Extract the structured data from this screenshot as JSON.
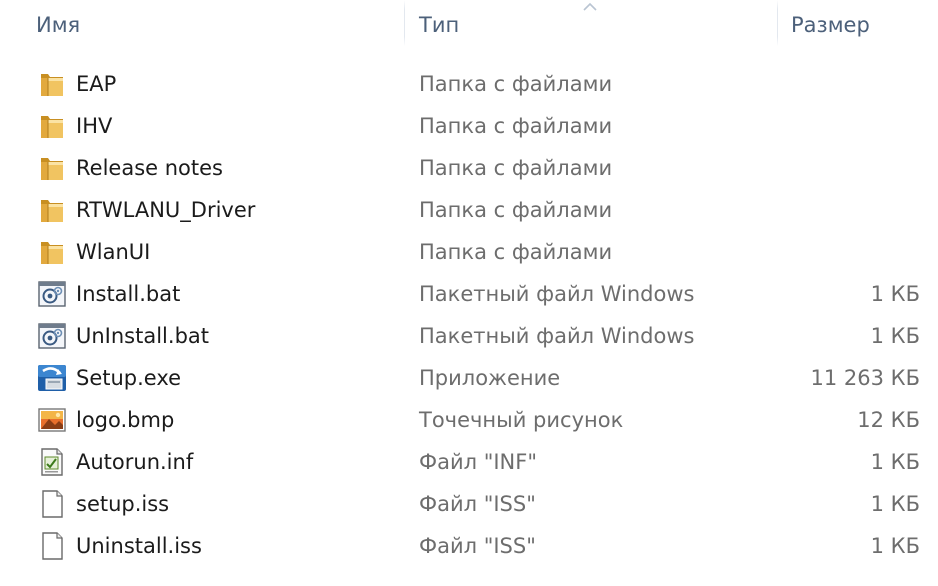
{
  "columns": {
    "name": "Имя",
    "type": "Тип",
    "size": "Размер"
  },
  "sort": {
    "column": "type",
    "direction": "ascending"
  },
  "colors": {
    "header_text": "#4c607a",
    "name_text": "#1b1b1b",
    "detail_text": "#6d6d6d",
    "folder": "#e8b44c"
  },
  "files": [
    {
      "name": "EAP",
      "type": "Папка с файлами",
      "size": "",
      "icon": "folder-icon"
    },
    {
      "name": "IHV",
      "type": "Папка с файлами",
      "size": "",
      "icon": "folder-icon"
    },
    {
      "name": "Release notes",
      "type": "Папка с файлами",
      "size": "",
      "icon": "folder-icon"
    },
    {
      "name": "RTWLANU_Driver",
      "type": "Папка с файлами",
      "size": "",
      "icon": "folder-icon"
    },
    {
      "name": "WlanUI",
      "type": "Папка с файлами",
      "size": "",
      "icon": "folder-icon"
    },
    {
      "name": "Install.bat",
      "type": "Пакетный файл Windows",
      "size": "1 КБ",
      "icon": "batch-file-icon"
    },
    {
      "name": "UnInstall.bat",
      "type": "Пакетный файл Windows",
      "size": "1 КБ",
      "icon": "batch-file-icon"
    },
    {
      "name": "Setup.exe",
      "type": "Приложение",
      "size": "11 263 КБ",
      "icon": "setup-installer-icon"
    },
    {
      "name": "logo.bmp",
      "type": "Точечный рисунок",
      "size": "12 КБ",
      "icon": "bitmap-image-icon"
    },
    {
      "name": "Autorun.inf",
      "type": "Файл \"INF\"",
      "size": "1 КБ",
      "icon": "inf-file-icon"
    },
    {
      "name": "setup.iss",
      "type": "Файл \"ISS\"",
      "size": "1 КБ",
      "icon": "blank-file-icon"
    },
    {
      "name": "Uninstall.iss",
      "type": "Файл \"ISS\"",
      "size": "1 КБ",
      "icon": "blank-file-icon"
    }
  ]
}
